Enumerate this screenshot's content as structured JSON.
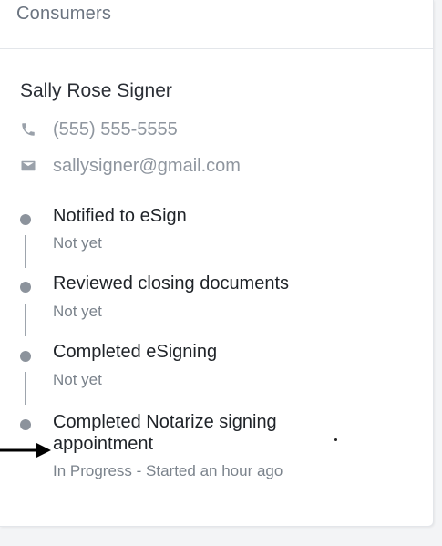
{
  "section": {
    "title": "Consumers"
  },
  "consumer": {
    "name": "Sally Rose Signer",
    "phone": "(555) 555-5555",
    "email": "sallysigner@gmail.com"
  },
  "icons": {
    "phone": "phone-icon",
    "email": "envelope-icon",
    "pointer": "arrow-right-icon"
  },
  "colors": {
    "muted_text": "#8f969f",
    "dot": "#8c939c",
    "title_text": "#1f2328"
  },
  "timeline": [
    {
      "title": "Notified to eSign",
      "status": "Not yet"
    },
    {
      "title": "Reviewed closing documents",
      "status": "Not yet"
    },
    {
      "title": "Completed eSigning",
      "status": "Not yet"
    },
    {
      "title_line1": "Completed Notarize signing",
      "title_line2": "appointment",
      "status": "In Progress - Started an hour ago"
    }
  ]
}
